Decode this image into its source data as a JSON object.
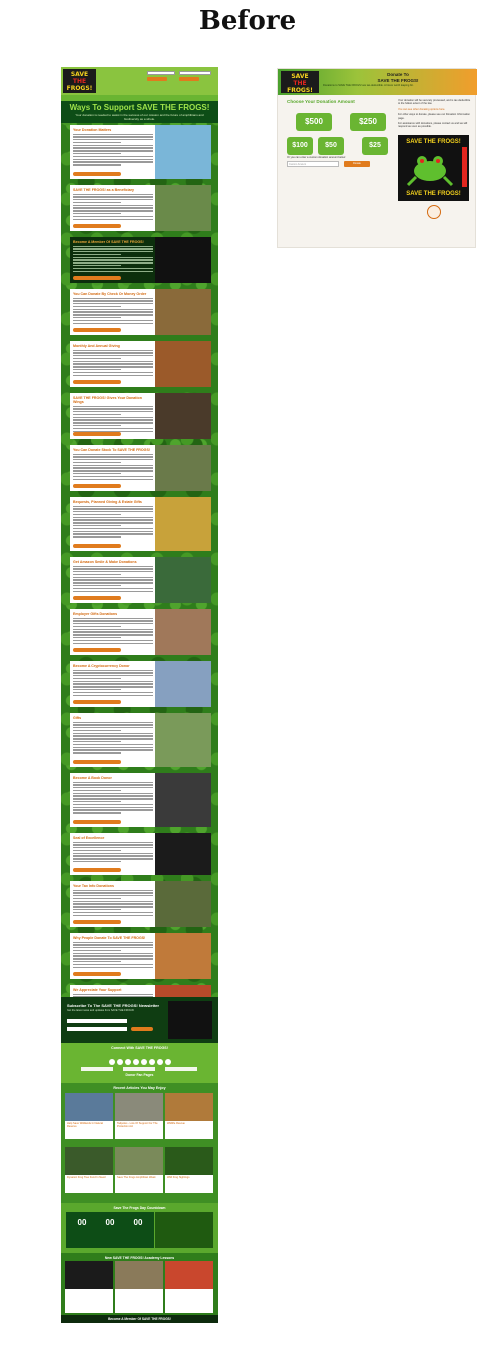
{
  "page_title": "Before",
  "left_page": {
    "logo": {
      "line1": "SAVE",
      "line2": "THE",
      "line3": "FROGS!"
    },
    "hero": {
      "title": "Ways To Support SAVE THE FROGS!",
      "subtitle": "Your donation is needed to assist in the success of our mission and the future of amphibians and biodiversity as a whole."
    },
    "cards": [
      {
        "title": "Your Donation Matters",
        "dark": false
      },
      {
        "title": "SAVE THE FROGS! as a Beneficiary",
        "dark": false
      },
      {
        "title": "Become A Member Of SAVE THE FROGS!",
        "dark": true
      },
      {
        "title": "You Can Donate By Check Or Money Order",
        "dark": false
      },
      {
        "title": "Monthly And Annual Giving",
        "dark": false
      },
      {
        "title": "SAVE THE FROGS! Gives Your Donation Wings",
        "dark": false
      },
      {
        "title": "You Can Donate Stock To SAVE THE FROGS!",
        "dark": false
      },
      {
        "title": "Bequests, Planned Giving & Estate Gifts",
        "dark": false
      },
      {
        "title": "Get Amazon Smile & Make Donations",
        "dark": false
      },
      {
        "title": "Employer Gifts Donations",
        "dark": false
      },
      {
        "title": "Become A Cryptocurrency Donor",
        "dark": false
      },
      {
        "title": "Gifts",
        "dark": false
      },
      {
        "title": "Become A Book Donor",
        "dark": false
      },
      {
        "title": "Seal of Excellence",
        "dark": false
      },
      {
        "title": "Your Tax Info Donations",
        "dark": false
      },
      {
        "title": "Why People Donate To SAVE THE FROGS!",
        "dark": false
      },
      {
        "title": "We Appreciate Your Support",
        "dark": false
      }
    ],
    "subscribe": {
      "title": "Subscribe To The SAVE THE FROGS! Newsletter",
      "text": "Get the latest news and updates from SAVE THE FROGS!"
    },
    "connect": {
      "title": "Connect With SAVE THE FROGS!",
      "pages_title": "Donor Fan Pages"
    },
    "articles": {
      "title": "Recent Articles You May Enjoy",
      "items": [
        "Help Save Wildlands In Natural Reserve",
        "Tadpoles - Lots Of Support For The Protection Act",
        "Wildlife Rescue",
        "Dynamic Frog Tree Fund In Need",
        "Save The Frogs Amphibian Week",
        "Wild Frog Sightings"
      ]
    },
    "countdown": {
      "title": "Save The Frogs Day Countdown",
      "values": [
        "00",
        "00",
        "00"
      ]
    },
    "new_section": {
      "title": "New SAVE THE FROGS! Academy Lessons"
    },
    "footer": "Become A Member Of SAVE THE FROGS!"
  },
  "right_page": {
    "logo": {
      "line1": "SAVE",
      "line2": "THE",
      "line3": "FROGS!"
    },
    "header_title_line1": "Donate To",
    "header_title_line2": "SAVE THE FROGS!",
    "header_desc": "Donations to SAVE THE FROGS! are tax-deductible. A future worth leaping for.",
    "choose_title": "Choose Your Donation Amount",
    "amounts": [
      "$500",
      "$250",
      "$100",
      "$50",
      "$25"
    ],
    "custom_label": "Or you can enter a custom donation amount below:",
    "custom_placeholder": "Custom Amount",
    "donate_button": "Donate",
    "info": [
      "Your donation will be securely processed, and is tax-deductible to the fullest extent of the law.",
      "You can see other donating options here.",
      "For other ways to donate, please see our Donation Information page.",
      "For assistance with donations, please contact us and we will respond as soon as possible."
    ],
    "poster_top": "SAVE THE FROGS!",
    "poster_bottom": "SAVE THE FROGS!"
  },
  "colors": {
    "green_dark": "#0d4d16",
    "green_mid": "#2f7d1b",
    "green_light": "#6ab532",
    "orange": "#e07b1d",
    "yellow": "#f4d21e",
    "red": "#e3261f"
  }
}
